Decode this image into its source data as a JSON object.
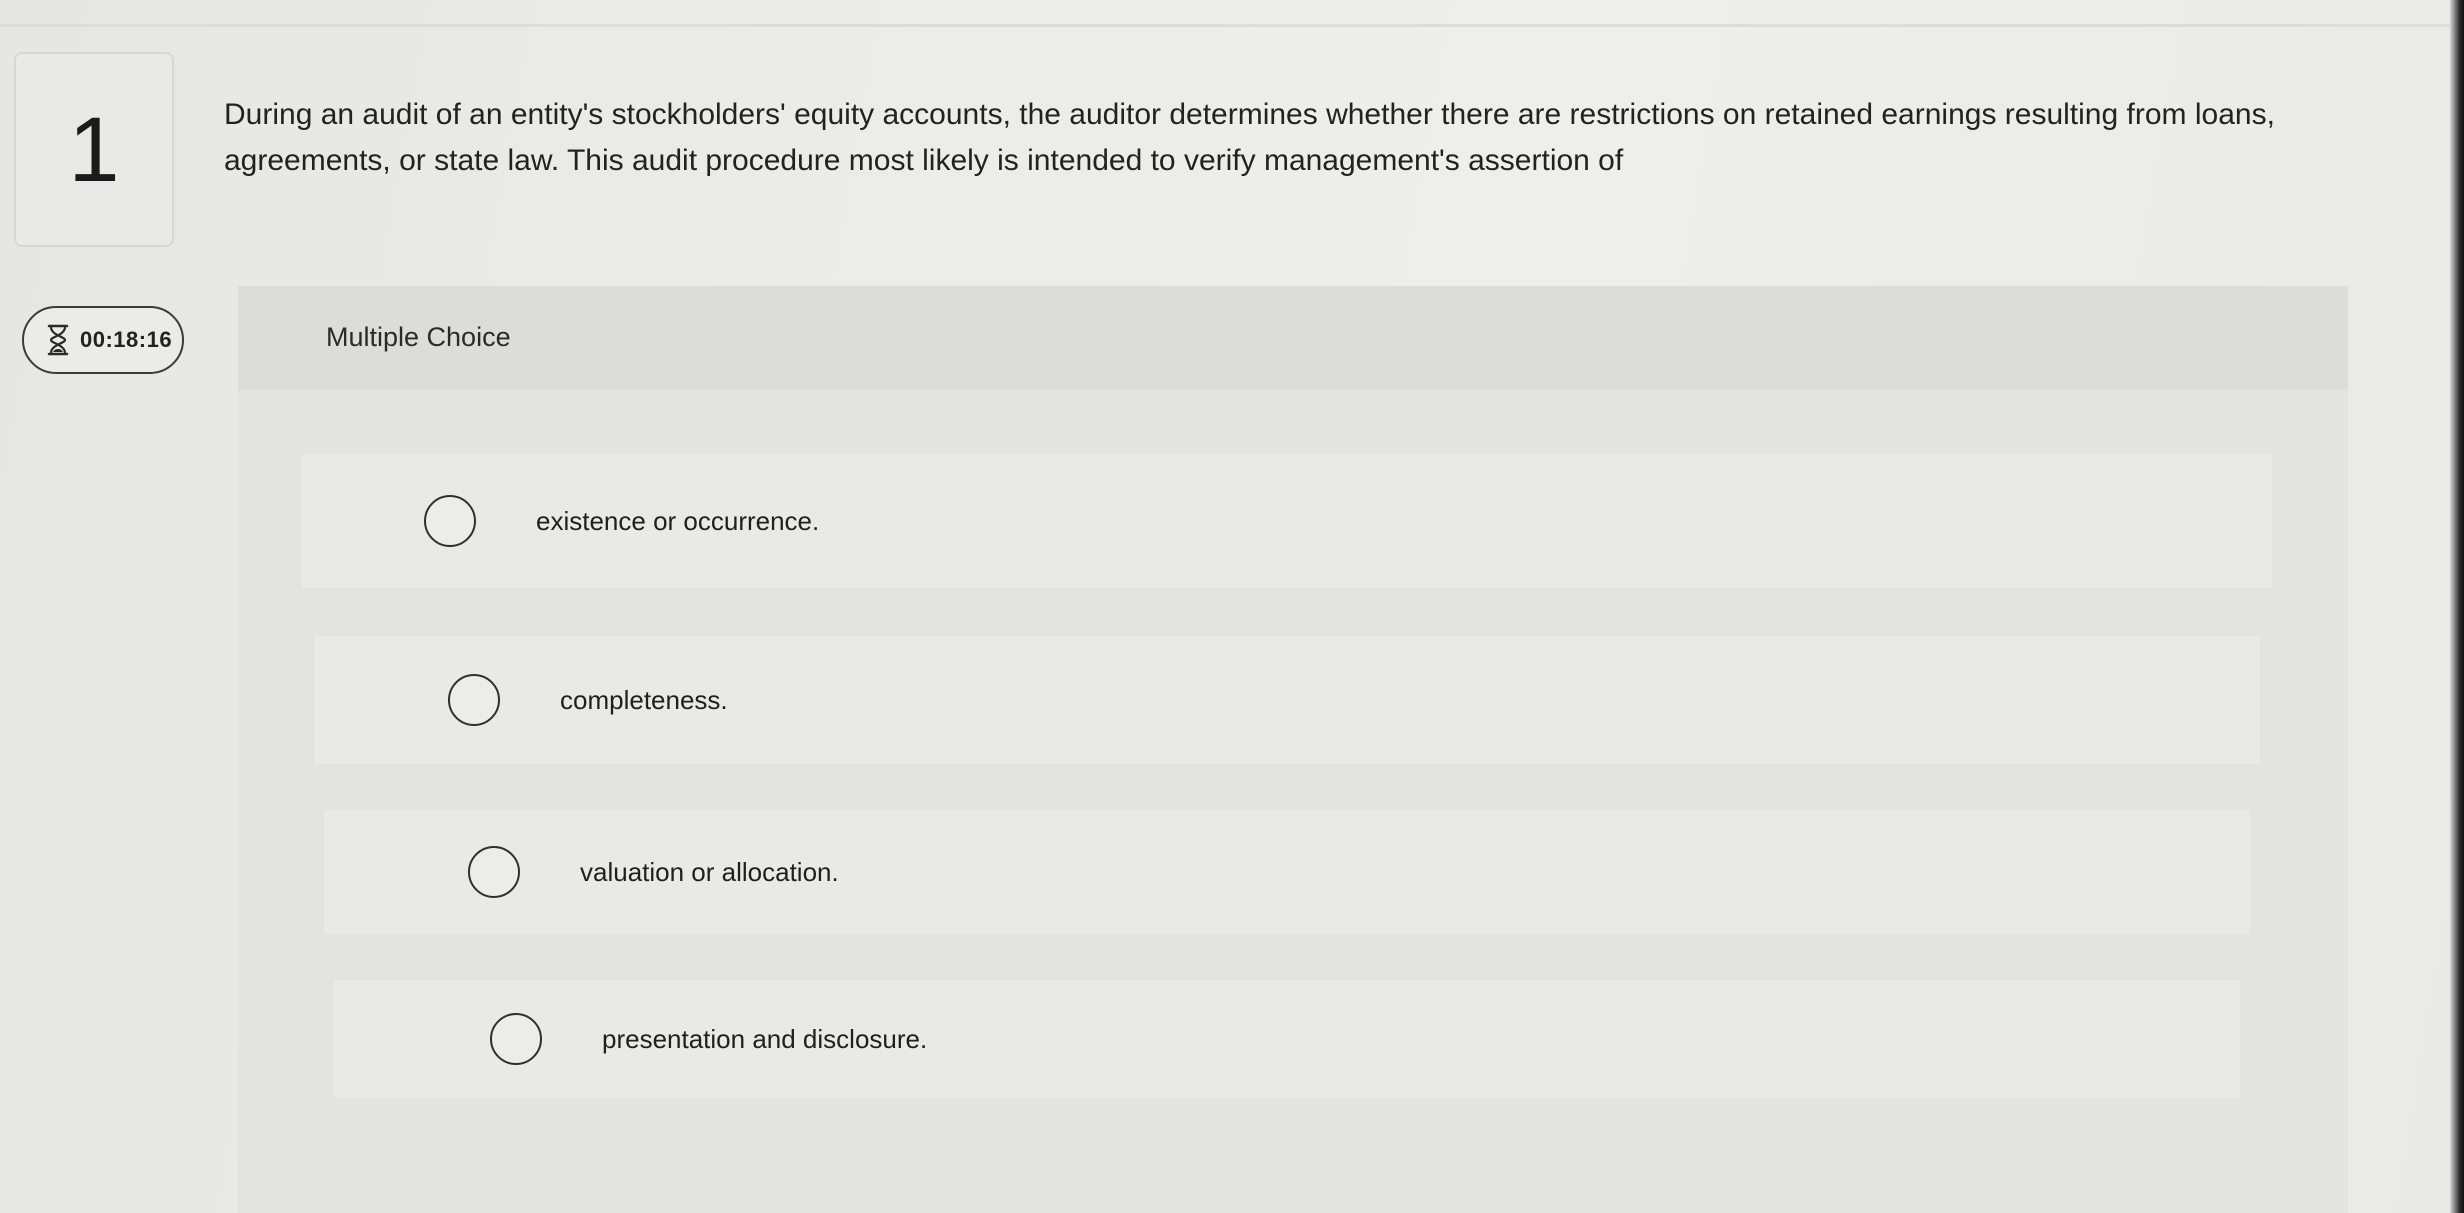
{
  "question": {
    "number": "1",
    "text": "During an audit of an entity's stockholders' equity accounts, the auditor determines whether there are restrictions on retained earnings resulting from loans, agreements, or state law. This audit procedure most likely is intended to verify management's assertion of"
  },
  "timer": {
    "icon": "hourglass-icon",
    "value": "00:18:16"
  },
  "panel": {
    "header": "Multiple Choice"
  },
  "options": [
    {
      "label": "existence or occurrence."
    },
    {
      "label": "completeness."
    },
    {
      "label": "valuation or allocation."
    },
    {
      "label": "presentation and disclosure."
    }
  ]
}
